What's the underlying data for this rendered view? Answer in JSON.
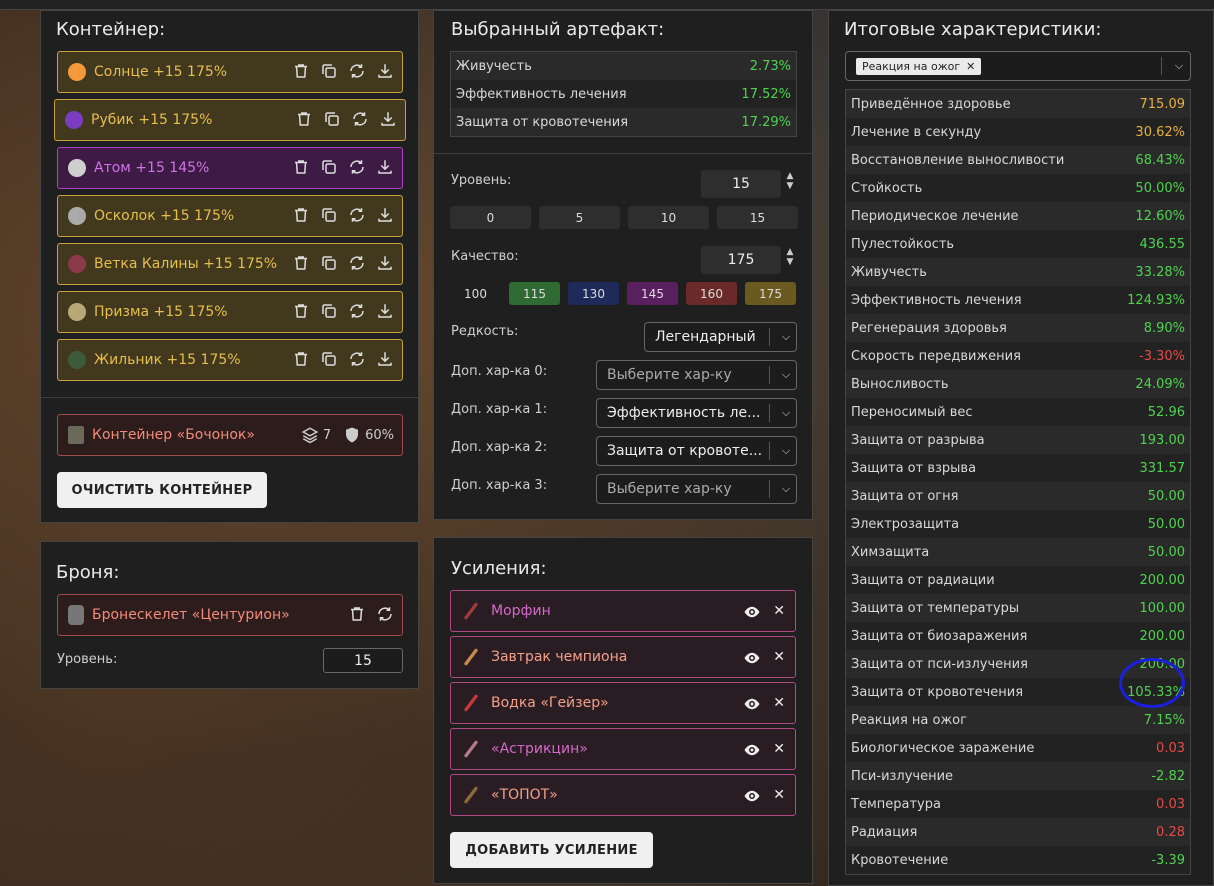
{
  "container": {
    "title": "Контейнер:",
    "slots": [
      {
        "label": "Солнце +15 175%",
        "rarity": "gold",
        "icon": "sun-icon",
        "color": "#f59a3a"
      },
      {
        "label": "Рубик +15 175%",
        "rarity": "gold",
        "icon": "cube-icon",
        "color": "#7b3cc2"
      },
      {
        "label": "Атом +15 145%",
        "rarity": "purple",
        "icon": "atom-icon",
        "color": "#cfcfcf"
      },
      {
        "label": "Осколок +15 175%",
        "rarity": "gold",
        "icon": "shard-icon",
        "color": "#aaaaaa"
      },
      {
        "label": "Ветка Калины +15 175%",
        "rarity": "gold",
        "icon": "branch-icon",
        "color": "#8a3a4a"
      },
      {
        "label": "Призма +15 175%",
        "rarity": "gold",
        "icon": "prism-icon",
        "color": "#b8a878"
      },
      {
        "label": "Жильник +15 175%",
        "rarity": "gold",
        "icon": "vein-icon",
        "color": "#3d5a3a"
      }
    ],
    "box": {
      "label": "Контейнер «Бочонок»",
      "slots": "7",
      "protection": "60%"
    },
    "clear_button": "ОЧИСТИТЬ КОНТЕЙНЕР"
  },
  "armor": {
    "title": "Броня:",
    "item": "Бронескелет «Центурион»",
    "level_label": "Уровень:",
    "level_value": "15"
  },
  "artifact": {
    "title": "Выбранный артефакт:",
    "stats": [
      {
        "name": "Живучесть",
        "value": "2.73%"
      },
      {
        "name": "Эффективность лечения",
        "value": "17.52%"
      },
      {
        "name": "Защита от кровотечения",
        "value": "17.29%"
      }
    ],
    "level_label": "Уровень:",
    "level_value": "15",
    "level_presets": [
      "0",
      "5",
      "10",
      "15"
    ],
    "quality_label": "Качество:",
    "quality_value": "175",
    "quality_presets": [
      {
        "label": "100",
        "color": "#1e1e1e"
      },
      {
        "label": "115",
        "color": "#2f6a32"
      },
      {
        "label": "130",
        "color": "#1f2a5a"
      },
      {
        "label": "145",
        "color": "#5a1f5e"
      },
      {
        "label": "160",
        "color": "#6a2a2a"
      },
      {
        "label": "175",
        "color": "#6a5a1f"
      }
    ],
    "rarity_label": "Редкость:",
    "rarity_value": "Легендарный",
    "extras": [
      {
        "label": "Доп. хар-ка 0:",
        "value": "",
        "placeholder": "Выберите хар-ку"
      },
      {
        "label": "Доп. хар-ка 1:",
        "value": "Эффективность ле...",
        "placeholder": ""
      },
      {
        "label": "Доп. хар-ка 2:",
        "value": "Защита от кровоте...",
        "placeholder": ""
      },
      {
        "label": "Доп. хар-ка 3:",
        "value": "",
        "placeholder": "Выберите хар-ку"
      }
    ]
  },
  "boosts": {
    "title": "Усиления:",
    "items": [
      {
        "label": "Морфин",
        "tone": "pink",
        "icon": "syringe-icon"
      },
      {
        "label": "Завтрак чемпиона",
        "tone": "salmon",
        "icon": "bowl-icon"
      },
      {
        "label": "Водка «Гейзер»",
        "tone": "salmon",
        "icon": "bottle-icon"
      },
      {
        "label": "«Астрикцин»",
        "tone": "pink",
        "icon": "injector-icon"
      },
      {
        "label": "«ТОПОТ»",
        "tone": "salmon",
        "icon": "stick-icon"
      }
    ],
    "add_button": "ДОБАВИТЬ УСИЛЕНИЕ"
  },
  "totals": {
    "title": "Итоговые характеристики:",
    "filter_tag": "Реакция на ожог",
    "rows": [
      {
        "name": "Приведённое здоровье",
        "value": "715.09",
        "tone": "orange"
      },
      {
        "name": "Лечение в секунду",
        "value": "30.62%",
        "tone": "orange"
      },
      {
        "name": "Восстановление выносливости",
        "value": "68.43%",
        "tone": "green"
      },
      {
        "name": "Стойкость",
        "value": "50.00%",
        "tone": "green"
      },
      {
        "name": "Периодическое лечение",
        "value": "12.60%",
        "tone": "green"
      },
      {
        "name": "Пулестойкость",
        "value": "436.55",
        "tone": "green"
      },
      {
        "name": "Живучесть",
        "value": "33.28%",
        "tone": "green"
      },
      {
        "name": "Эффективность лечения",
        "value": "124.93%",
        "tone": "green"
      },
      {
        "name": "Регенерация здоровья",
        "value": "8.90%",
        "tone": "green"
      },
      {
        "name": "Скорость передвижения",
        "value": "-3.30%",
        "tone": "red"
      },
      {
        "name": "Выносливость",
        "value": "24.09%",
        "tone": "green"
      },
      {
        "name": "Переносимый вес",
        "value": "52.96",
        "tone": "green"
      },
      {
        "name": "Защита от разрыва",
        "value": "193.00",
        "tone": "green"
      },
      {
        "name": "Защита от взрыва",
        "value": "331.57",
        "tone": "green"
      },
      {
        "name": "Защита от огня",
        "value": "50.00",
        "tone": "green"
      },
      {
        "name": "Электрозащита",
        "value": "50.00",
        "tone": "green"
      },
      {
        "name": "Химзащита",
        "value": "50.00",
        "tone": "green"
      },
      {
        "name": "Защита от радиации",
        "value": "200.00",
        "tone": "green"
      },
      {
        "name": "Защита от температуры",
        "value": "100.00",
        "tone": "green"
      },
      {
        "name": "Защита от биозаражения",
        "value": "200.00",
        "tone": "green"
      },
      {
        "name": "Защита от пси-излучения",
        "value": "200.00",
        "tone": "green"
      },
      {
        "name": "Защита от кровотечения",
        "value": "105.33%",
        "tone": "green"
      },
      {
        "name": "Реакция на ожог",
        "value": "7.15%",
        "tone": "green"
      },
      {
        "name": "Биологическое заражение",
        "value": "0.03",
        "tone": "red"
      },
      {
        "name": "Пси-излучение",
        "value": "-2.82",
        "tone": "green"
      },
      {
        "name": "Температура",
        "value": "0.03",
        "tone": "red"
      },
      {
        "name": "Радиация",
        "value": "0.28",
        "tone": "red"
      },
      {
        "name": "Кровотечение",
        "value": "-3.39",
        "tone": "green"
      }
    ]
  }
}
